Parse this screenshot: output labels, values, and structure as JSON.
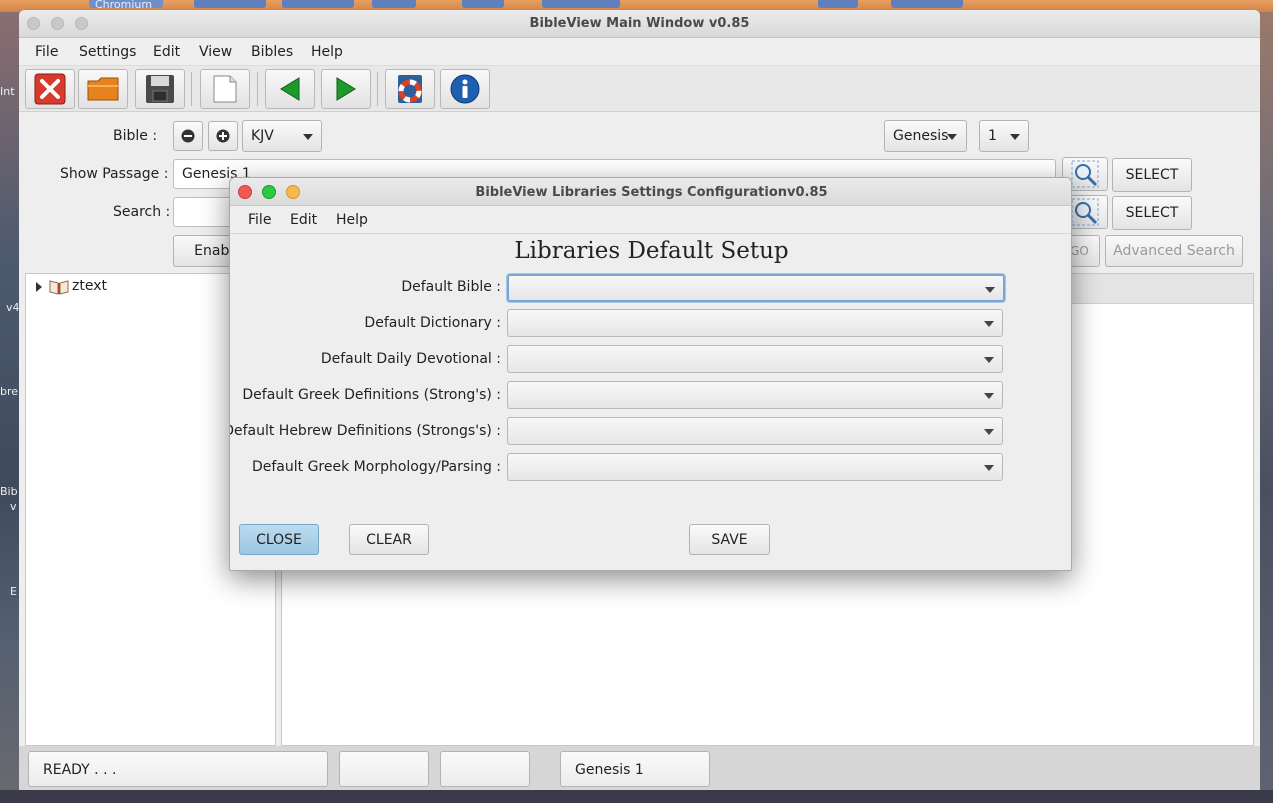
{
  "desktop": {
    "side_texts": [
      "Int",
      "v4",
      "bre",
      "Bib",
      "v",
      "E"
    ],
    "top_tab": "Chromium"
  },
  "main_window": {
    "title": "BibleView Main Window v0.85",
    "menu": [
      "File",
      "Settings",
      "Edit",
      "View",
      "Bibles",
      "Help"
    ],
    "toolbar": [
      "close-red-x-icon",
      "open-folder-icon",
      "save-disk-icon",
      "new-document-icon",
      "back-arrow-icon",
      "forward-arrow-icon",
      "lifebuoy-book-icon",
      "info-icon"
    ],
    "bible_label": "Bible :",
    "bible_value": "KJV",
    "book_value": "Genesis",
    "chapter_value": "1",
    "passage_label": "Show Passage :",
    "passage_value": "Genesis 1",
    "search_label": "Search :",
    "search_value": "",
    "select_label": "SELECT",
    "enable_label": "Enable",
    "go_label": "GO",
    "advanced_search_label": "Advanced Search",
    "tree_root": "ztext",
    "status": {
      "ready": "READY . . .",
      "box2": "",
      "box3": "",
      "passage": "Genesis 1"
    }
  },
  "dialog": {
    "title": "BibleView Libraries Settings Configurationv0.85",
    "menu": [
      "File",
      "Edit",
      "Help"
    ],
    "heading": "Libraries Default Setup",
    "rows": [
      {
        "label": "Default Bible :",
        "value": ""
      },
      {
        "label": "Default Dictionary :",
        "value": ""
      },
      {
        "label": "Default Daily Devotional :",
        "value": ""
      },
      {
        "label": "Default Greek Definitions (Strong's) :",
        "value": ""
      },
      {
        "label": "Default Hebrew Definitions (Strongs's) :",
        "value": ""
      },
      {
        "label": "Default Greek Morphology/Parsing :",
        "value": ""
      }
    ],
    "close_label": "CLOSE",
    "clear_label": "CLEAR",
    "save_label": "SAVE",
    "colors": {
      "close_dot": "#ee5a52",
      "minimize_dot": "#2fc841",
      "zoom_dot": "#f6b94a",
      "close_button": "#a9cfe8"
    }
  }
}
